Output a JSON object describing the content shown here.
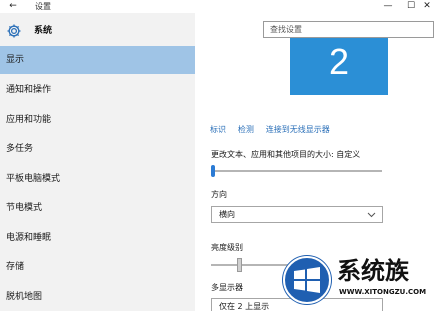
{
  "window": {
    "title": "设置",
    "back_glyph": "←",
    "min_glyph": "—",
    "max_glyph": "☐",
    "close_glyph": "✕"
  },
  "sidebar": {
    "header_icon": "gear-icon",
    "header_label": "系统",
    "items": [
      {
        "label": "显示",
        "active": true
      },
      {
        "label": "通知和操作",
        "active": false
      },
      {
        "label": "应用和功能",
        "active": false
      },
      {
        "label": "多任务",
        "active": false
      },
      {
        "label": "平板电脑模式",
        "active": false
      },
      {
        "label": "节电模式",
        "active": false
      },
      {
        "label": "电源和睡眠",
        "active": false
      },
      {
        "label": "存储",
        "active": false
      },
      {
        "label": "脱机地图",
        "active": false
      }
    ]
  },
  "search": {
    "placeholder": "查找设置",
    "value": ""
  },
  "display": {
    "monitor_number": "2",
    "links": [
      "标识",
      "检测",
      "连接到无线显示器"
    ],
    "scale_label": "更改文本、应用和其他项目的大小: 自定义",
    "scale_level": 0,
    "orientation_label": "方向",
    "orientation_value": "横向",
    "brightness_label": "亮度级别",
    "brightness_level": 0.3,
    "multiple_displays_label": "多显示器",
    "multiple_displays_value": "仅在 2 上显示"
  },
  "watermark": {
    "text": "系统族",
    "url": "WWW.XITONGZU.COM"
  },
  "colors": {
    "accent": "#2b8fd6",
    "selection": "#9fc4e6",
    "link": "#2a6fb8",
    "sidebar_bg": "#f2f2f2"
  }
}
